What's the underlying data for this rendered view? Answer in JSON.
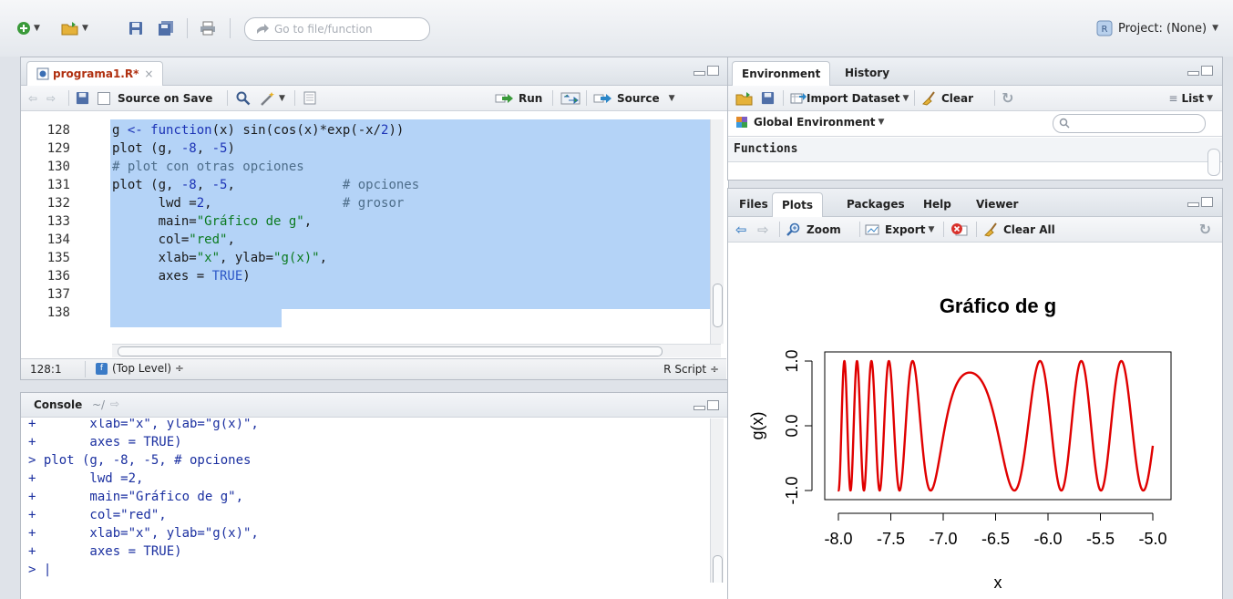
{
  "toolbar": {
    "goto_placeholder": "Go to file/function",
    "project_label": "Project: (None)"
  },
  "editor": {
    "tab_label": "programa1.R*",
    "source_on_save_label": "Source on Save",
    "run_label": "Run",
    "source_label": "Source",
    "line_numbers": [
      "128",
      "129",
      "130",
      "131",
      "132",
      "133",
      "134",
      "135",
      "136",
      "137",
      "138"
    ],
    "cursor_position": "128:1",
    "scope_label": "(Top Level) ÷",
    "file_type_label": "R Script ÷"
  },
  "console": {
    "title": "Console",
    "path": "~/",
    "lines": [
      "+       xlab=\"x\", ylab=\"g(x)\",",
      "+       axes = TRUE)",
      "> plot (g, -8, -5, # opciones",
      "+       lwd =2,",
      "+       main=\"Gráfico de g\",",
      "+       col=\"red\",",
      "+       xlab=\"x\", ylab=\"g(x)\",",
      "+       axes = TRUE)",
      "> |"
    ]
  },
  "environment": {
    "tabs": [
      "Environment",
      "History"
    ],
    "import_dataset_label": "Import Dataset",
    "clear_label": "Clear",
    "list_label": "List",
    "scope_label": "Global Environment",
    "section_label": "Functions"
  },
  "files_pane": {
    "tabs": [
      "Files",
      "Plots",
      "Packages",
      "Help",
      "Viewer"
    ],
    "zoom_label": "Zoom",
    "export_label": "Export",
    "clear_all_label": "Clear All"
  },
  "chart_data": {
    "type": "line",
    "title": "Gráfico de g",
    "xlabel": "x",
    "ylabel": "g(x)",
    "function": "sin(cos(x)*exp(-x/2))",
    "xlim": [
      -8,
      -5
    ],
    "ylim": [
      -1.0,
      1.0
    ],
    "x_ticks": [
      "-8.0",
      "-7.5",
      "-7.0",
      "-6.5",
      "-6.0",
      "-5.5",
      "-5.0"
    ],
    "y_ticks": [
      "-1.0",
      "0.0",
      "1.0"
    ],
    "series": [
      {
        "color": "#e00000"
      }
    ],
    "grid": false
  }
}
